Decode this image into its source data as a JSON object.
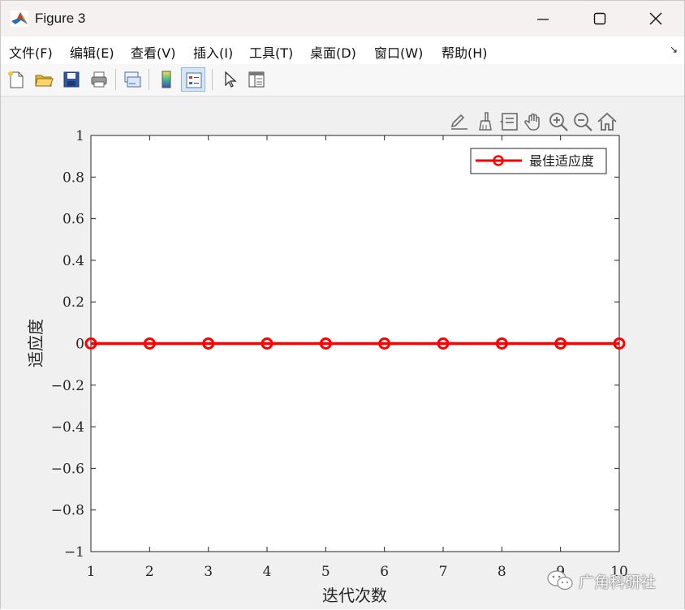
{
  "window": {
    "title": "Figure 3"
  },
  "menu": {
    "items": [
      "文件(F)",
      "编辑(E)",
      "查看(V)",
      "插入(I)",
      "工具(T)",
      "桌面(D)",
      "窗口(W)",
      "帮助(H)"
    ],
    "overflow_arrow": "↘"
  },
  "toolbar": {
    "icons": [
      "new-figure-icon",
      "open-icon",
      "save-icon",
      "print-icon",
      "link-plot-icon",
      "colorbar-icon",
      "legend-icon",
      "pointer-icon",
      "property-inspector-icon"
    ]
  },
  "axes_toolbar": {
    "icons": [
      "edit-plot-icon",
      "brush-icon",
      "data-tips-icon",
      "pan-icon",
      "zoom-in-icon",
      "zoom-out-icon",
      "home-icon"
    ]
  },
  "chart_data": {
    "type": "line",
    "x": [
      1,
      2,
      3,
      4,
      5,
      6,
      7,
      8,
      9,
      10
    ],
    "series": [
      {
        "name": "最佳适应度",
        "values": [
          0,
          0,
          0,
          0,
          0,
          0,
          0,
          0,
          0,
          0
        ],
        "color": "#ff0000",
        "marker": "circle"
      }
    ],
    "xlabel": "迭代次数",
    "ylabel": "适应度",
    "xlim": [
      1,
      10
    ],
    "ylim": [
      -1,
      1
    ],
    "xticks": [
      "1",
      "2",
      "3",
      "4",
      "5",
      "6",
      "7",
      "8",
      "9",
      "10"
    ],
    "yticks": [
      "1",
      "0.8",
      "0.6",
      "0.4",
      "0.2",
      "0",
      "−0.2",
      "−0.4",
      "−0.6",
      "−0.8",
      "−1"
    ],
    "ytick_values": [
      1,
      0.8,
      0.6,
      0.4,
      0.2,
      0,
      -0.2,
      -0.4,
      -0.6,
      -0.8,
      -1
    ],
    "grid": false,
    "legend_position": "top-right"
  },
  "watermark": {
    "text": "广角科研社"
  },
  "colors": {
    "plot_line": "#ff0000",
    "figure_bg": "#f0f0f0",
    "titlebar_bg": "#f5f1f1"
  }
}
